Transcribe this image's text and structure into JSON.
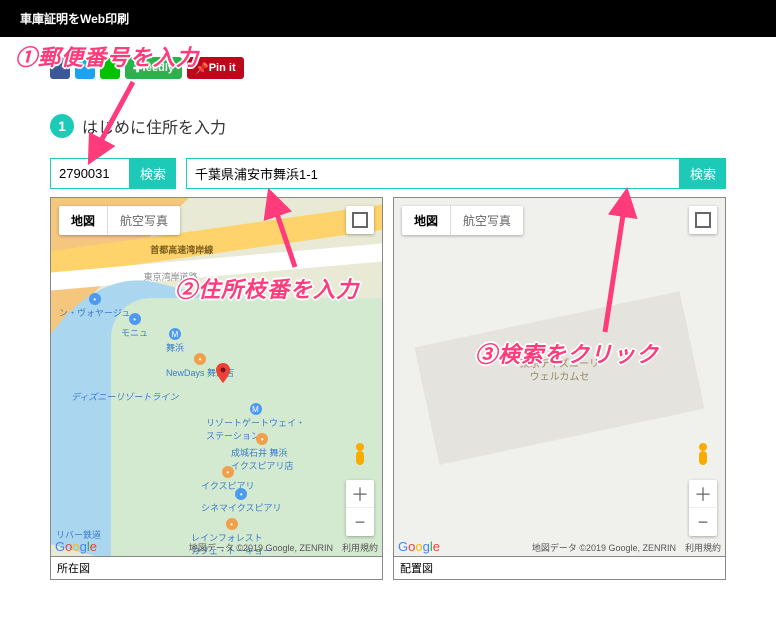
{
  "header": {
    "title": "車庫証明をWeb印刷"
  },
  "share": {
    "feedly": "feedly",
    "pinit": "Pin it"
  },
  "step": {
    "num": "1",
    "text": "はじめに住所を入力"
  },
  "inputs": {
    "zip_value": "2790031",
    "zip_search": "検索",
    "addr_value": "千葉県浦安市舞浜1-1",
    "addr_search": "検索"
  },
  "map": {
    "tab_map": "地図",
    "tab_sat": "航空写真",
    "attribution": "地図データ ©2019 Google, ZENRIN　利用規約",
    "label_left": "所在図",
    "label_right": "配置図",
    "roads": {
      "expressway": "首都高速湾岸線",
      "wangan": "東京湾岸道路"
    },
    "pois": {
      "voyage": "ン・ヴォヤージュ",
      "monu": "モニュ",
      "station": "舞浜",
      "newdays": "NewDays 舞浜店",
      "resort_line": "ディズニーリゾートライン",
      "resort_gw": "リゾートゲートウェイ・\nステーション",
      "seijo": "成城石井 舞浜\nイクスピアリ店",
      "ikspiari": "イクスピアリ",
      "cinema": "シネマイクスピアリ",
      "rainforest": "レインフォレスト\nカフェ・トーキョー",
      "railway": "リバー鉄道"
    },
    "building_label": "東京ディズニーリ\nウェルカムセ",
    "zoom_in": "＋",
    "zoom_out": "−"
  },
  "annotations": {
    "a1": "①郵便番号を入力",
    "a2": "②住所枝番を入力",
    "a3": "③検索をクリック"
  }
}
